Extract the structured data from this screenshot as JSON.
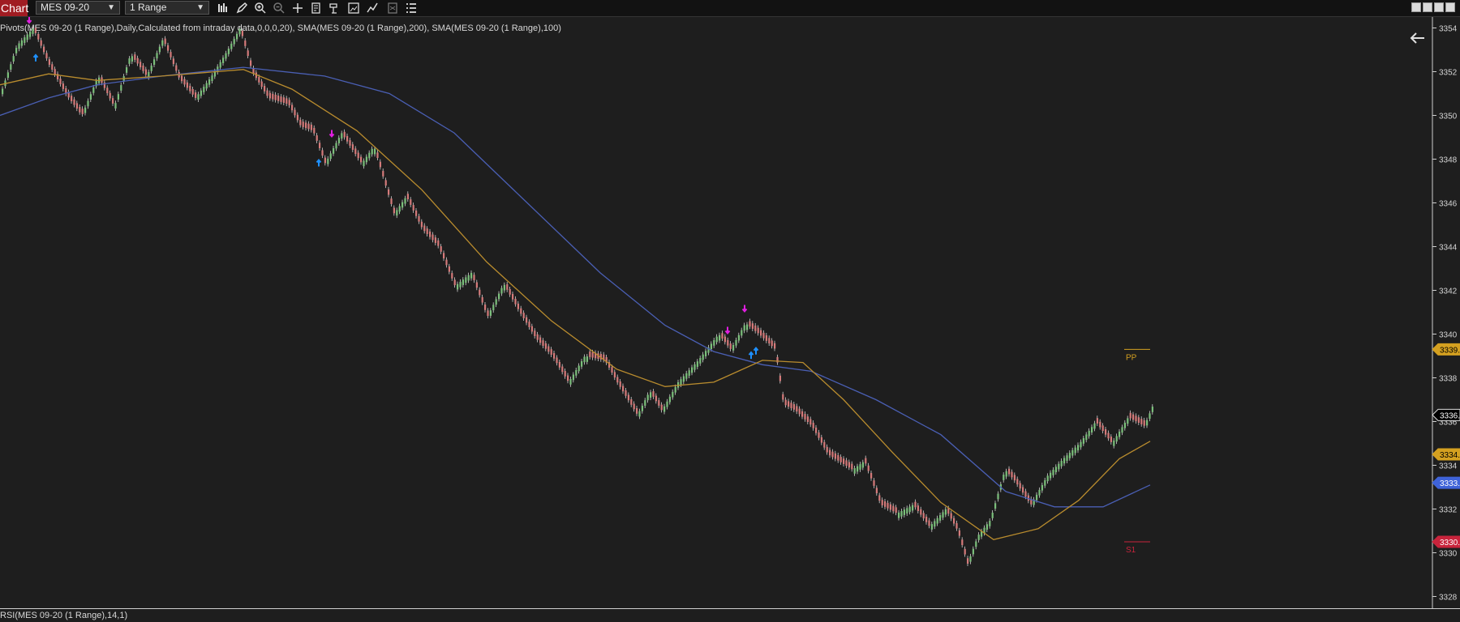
{
  "toolbar": {
    "chart_tab": "Chart",
    "instrument": "MES 09-20",
    "interval": "1 Range",
    "tools": [
      "bar-type-icon",
      "pencil-draw-icon",
      "zoom-in-icon",
      "zoom-out-icon",
      "crosshair-icon",
      "properties-icon",
      "data-box-icon",
      "screenshot-icon",
      "strategy-icon",
      "template-icon",
      "indicators-list-icon"
    ]
  },
  "indicator_label": "Pivots(MES 09-20 (1 Range),Daily,Calculated from intraday data,0,0,0,20), SMA(MES 09-20 (1 Range),200), SMA(MES 09-20 (1 Range),100)",
  "rsi_label": "RSI(MES 09-20 (1 Range),14,1)",
  "colors": {
    "background": "#1e1e1e",
    "up_bar": "#7bbf7b",
    "down_bar": "#d47a7a",
    "sma200": "#4a5fb4",
    "sma100": "#b98c2e",
    "pivot": "#d4a020",
    "s1": "#c8243c",
    "buy_arrow": "#1e90ff",
    "sell_arrow": "#e01ee0"
  },
  "chart_data": {
    "type": "line",
    "ylim": [
      3327.5,
      3354.5
    ],
    "y_ticks": [
      3354,
      3352,
      3350,
      3348,
      3346,
      3344,
      3342,
      3340,
      3338,
      3336,
      3334,
      3332,
      3330,
      3328
    ],
    "y_tick_labels": [
      "3354",
      "3352",
      "3350",
      "3348",
      "3346",
      "3344",
      "3342",
      "3340",
      "3338",
      "3336",
      "3334",
      "3332",
      "3330",
      "3328"
    ],
    "price_path": [
      [
        0,
        3351.0
      ],
      [
        20,
        3353.2
      ],
      [
        40,
        3354.0
      ],
      [
        60,
        3352.3
      ],
      [
        80,
        3351.0
      ],
      [
        100,
        3350.0
      ],
      [
        120,
        3351.8
      ],
      [
        140,
        3350.4
      ],
      [
        160,
        3352.8
      ],
      [
        180,
        3351.8
      ],
      [
        200,
        3353.5
      ],
      [
        220,
        3351.7
      ],
      [
        240,
        3350.8
      ],
      [
        260,
        3351.8
      ],
      [
        280,
        3353.0
      ],
      [
        295,
        3354.0
      ],
      [
        310,
        3352.0
      ],
      [
        330,
        3350.8
      ],
      [
        355,
        3350.5
      ],
      [
        370,
        3349.5
      ],
      [
        385,
        3349.3
      ],
      [
        400,
        3347.8
      ],
      [
        420,
        3349.2
      ],
      [
        445,
        3347.8
      ],
      [
        460,
        3348.6
      ],
      [
        485,
        3345.5
      ],
      [
        500,
        3346.3
      ],
      [
        520,
        3344.8
      ],
      [
        540,
        3344.0
      ],
      [
        560,
        3342.2
      ],
      [
        580,
        3342.8
      ],
      [
        600,
        3340.8
      ],
      [
        620,
        3342.3
      ],
      [
        640,
        3341.0
      ],
      [
        660,
        3339.8
      ],
      [
        680,
        3339.0
      ],
      [
        700,
        3337.8
      ],
      [
        720,
        3339.0
      ],
      [
        745,
        3338.8
      ],
      [
        760,
        3337.8
      ],
      [
        785,
        3336.3
      ],
      [
        800,
        3337.4
      ],
      [
        815,
        3336.5
      ],
      [
        835,
        3337.8
      ],
      [
        860,
        3338.8
      ],
      [
        885,
        3340.0
      ],
      [
        900,
        3339.3
      ],
      [
        918,
        3340.5
      ],
      [
        935,
        3340.0
      ],
      [
        955,
        3339.3
      ],
      [
        965,
        3336.8
      ],
      [
        980,
        3336.5
      ],
      [
        1000,
        3335.8
      ],
      [
        1020,
        3334.5
      ],
      [
        1050,
        3333.8
      ],
      [
        1065,
        3334.2
      ],
      [
        1085,
        3332.2
      ],
      [
        1105,
        3331.8
      ],
      [
        1125,
        3332.2
      ],
      [
        1145,
        3331.2
      ],
      [
        1165,
        3332.0
      ],
      [
        1180,
        3331.0
      ],
      [
        1192,
        3329.5
      ],
      [
        1205,
        3330.8
      ],
      [
        1220,
        3331.5
      ],
      [
        1238,
        3333.8
      ],
      [
        1250,
        3333.3
      ],
      [
        1270,
        3332.2
      ],
      [
        1290,
        3333.5
      ],
      [
        1310,
        3334.3
      ],
      [
        1330,
        3335.0
      ],
      [
        1350,
        3336.0
      ],
      [
        1370,
        3335.0
      ],
      [
        1390,
        3336.2
      ],
      [
        1410,
        3335.8
      ],
      [
        1420,
        3336.7
      ]
    ],
    "series": [
      {
        "name": "SMA(MES 09-20 (1 Range),200)",
        "points": [
          [
            0,
            3350.0
          ],
          [
            60,
            3350.8
          ],
          [
            120,
            3351.4
          ],
          [
            200,
            3351.8
          ],
          [
            300,
            3352.2
          ],
          [
            400,
            3351.8
          ],
          [
            480,
            3351.0
          ],
          [
            560,
            3349.2
          ],
          [
            650,
            3346.0
          ],
          [
            740,
            3342.8
          ],
          [
            820,
            3340.4
          ],
          [
            880,
            3339.2
          ],
          [
            940,
            3338.6
          ],
          [
            1000,
            3338.3
          ],
          [
            1080,
            3337.0
          ],
          [
            1160,
            3335.4
          ],
          [
            1240,
            3332.8
          ],
          [
            1300,
            3332.1
          ],
          [
            1360,
            3332.1
          ],
          [
            1418,
            3333.1
          ]
        ]
      },
      {
        "name": "SMA(MES 09-20 (1 Range),100)",
        "points": [
          [
            0,
            3351.4
          ],
          [
            60,
            3351.9
          ],
          [
            120,
            3351.6
          ],
          [
            200,
            3351.8
          ],
          [
            300,
            3352.1
          ],
          [
            360,
            3351.2
          ],
          [
            440,
            3349.3
          ],
          [
            520,
            3346.6
          ],
          [
            600,
            3343.3
          ],
          [
            680,
            3340.6
          ],
          [
            760,
            3338.4
          ],
          [
            820,
            3337.6
          ],
          [
            880,
            3337.8
          ],
          [
            940,
            3338.8
          ],
          [
            990,
            3338.7
          ],
          [
            1040,
            3337.0
          ],
          [
            1100,
            3334.6
          ],
          [
            1160,
            3332.3
          ],
          [
            1225,
            3330.6
          ],
          [
            1280,
            3331.1
          ],
          [
            1330,
            3332.4
          ],
          [
            1380,
            3334.3
          ],
          [
            1418,
            3335.1
          ]
        ]
      }
    ],
    "pivot_lines": [
      {
        "label": "PP",
        "value": 3339.3,
        "x0": 1386,
        "x1": 1418
      },
      {
        "label": "S1",
        "value": 3330.5,
        "x0": 1386,
        "x1": 1418
      }
    ],
    "price_markers": [
      {
        "value": 3339.3,
        "label": "3339.",
        "kind": "pivot"
      },
      {
        "value": 3336.3,
        "label": "3336.",
        "kind": "last"
      },
      {
        "value": 3334.5,
        "label": "3334.",
        "kind": "sma100"
      },
      {
        "value": 3333.2,
        "label": "3333.",
        "kind": "sma200"
      },
      {
        "value": 3330.5,
        "label": "3330.",
        "kind": "s1"
      }
    ],
    "signals": [
      {
        "x": 36,
        "y": 3354.2,
        "type": "sell"
      },
      {
        "x": 44,
        "y": 3352.8,
        "type": "buy"
      },
      {
        "x": 393,
        "y": 3348.0,
        "type": "buy"
      },
      {
        "x": 409,
        "y": 3349.0,
        "type": "sell"
      },
      {
        "x": 897,
        "y": 3340.0,
        "type": "sell"
      },
      {
        "x": 918,
        "y": 3341.0,
        "type": "sell"
      },
      {
        "x": 926,
        "y": 3339.2,
        "type": "buy"
      },
      {
        "x": 932,
        "y": 3339.4,
        "type": "buy"
      }
    ]
  }
}
